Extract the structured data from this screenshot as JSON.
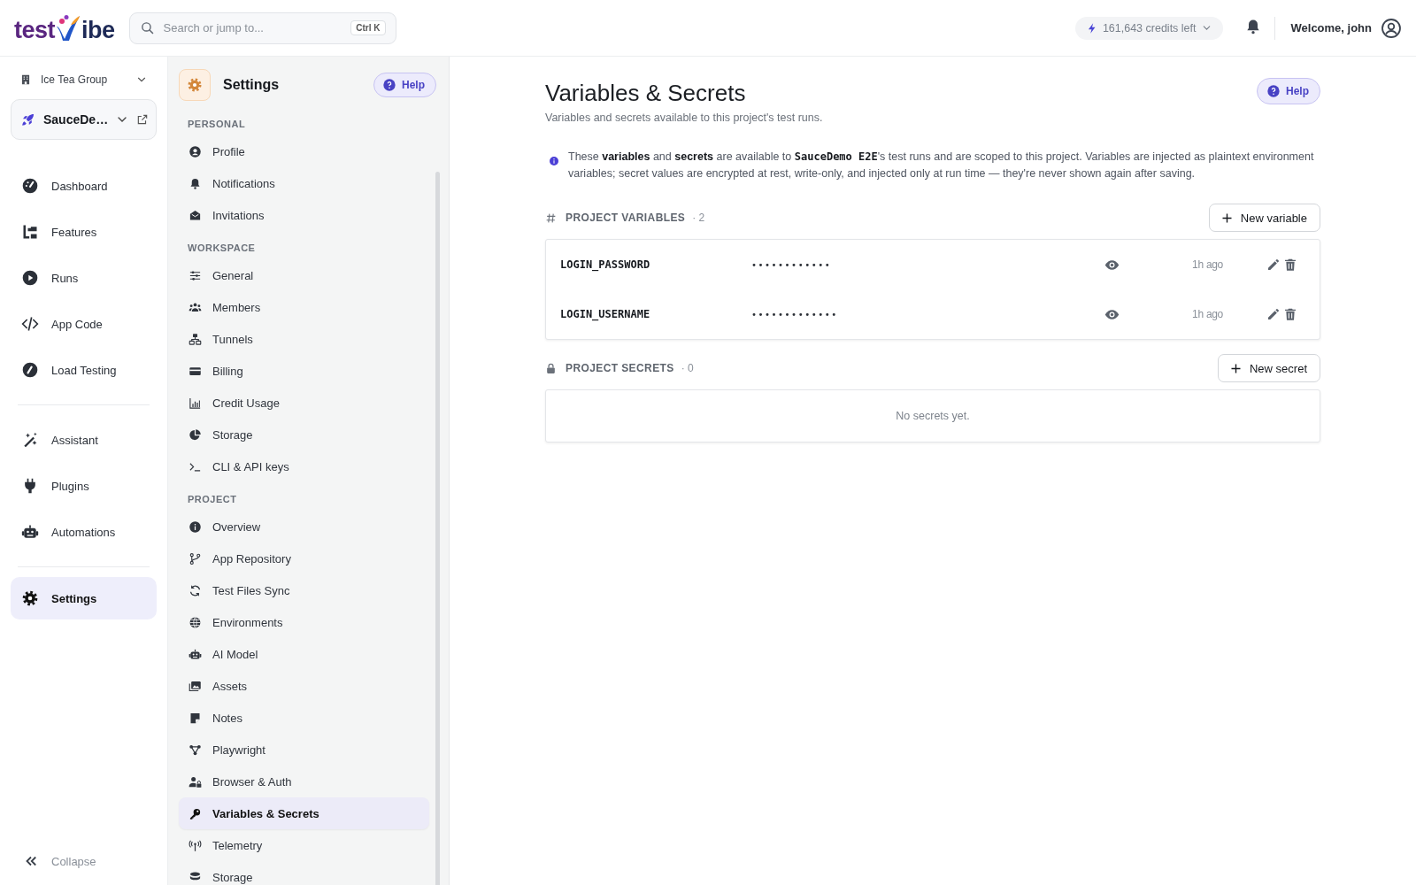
{
  "logo": {
    "before": "test",
    "after": "ibe"
  },
  "search": {
    "placeholder": "Search or jump to...",
    "shortcut": "Ctrl K"
  },
  "credits": "161,643 credits left",
  "welcome": "Welcome, john",
  "workspace": "Ice Tea Group",
  "project": "SauceDe…",
  "nav": {
    "groups": [
      [
        {
          "label": "Dashboard",
          "selected": false
        },
        {
          "label": "Features",
          "selected": false
        },
        {
          "label": "Runs",
          "selected": false
        },
        {
          "label": "App Code",
          "selected": false
        },
        {
          "label": "Load Testing",
          "selected": false
        }
      ],
      [
        {
          "label": "Assistant",
          "selected": false
        },
        {
          "label": "Plugins",
          "selected": false
        },
        {
          "label": "Automations",
          "selected": false
        }
      ],
      [
        {
          "label": "Settings",
          "selected": true
        }
      ]
    ]
  },
  "collapse": "Collapse",
  "settings_nav": {
    "title": "Settings",
    "help": "Help",
    "sections": [
      {
        "heading": "PERSONAL",
        "items": [
          {
            "label": "Profile",
            "selected": false
          },
          {
            "label": "Notifications",
            "selected": false
          },
          {
            "label": "Invitations",
            "selected": false
          }
        ]
      },
      {
        "heading": "WORKSPACE",
        "items": [
          {
            "label": "General",
            "selected": false
          },
          {
            "label": "Members",
            "selected": false
          },
          {
            "label": "Tunnels",
            "selected": false
          },
          {
            "label": "Billing",
            "selected": false
          },
          {
            "label": "Credit Usage",
            "selected": false
          },
          {
            "label": "Storage",
            "selected": false
          },
          {
            "label": "CLI & API keys",
            "selected": false
          }
        ]
      },
      {
        "heading": "PROJECT",
        "items": [
          {
            "label": "Overview",
            "selected": false
          },
          {
            "label": "App Repository",
            "selected": false
          },
          {
            "label": "Test Files Sync",
            "selected": false
          },
          {
            "label": "Environments",
            "selected": false
          },
          {
            "label": "AI Model",
            "selected": false
          },
          {
            "label": "Assets",
            "selected": false
          },
          {
            "label": "Notes",
            "selected": false
          },
          {
            "label": "Playwright",
            "selected": false
          },
          {
            "label": "Browser & Auth",
            "selected": false
          },
          {
            "label": "Variables & Secrets",
            "selected": true
          },
          {
            "label": "Telemetry",
            "selected": false
          },
          {
            "label": "Storage",
            "selected": false
          }
        ]
      }
    ]
  },
  "page": {
    "title": "Variables & Secrets",
    "subtitle": "Variables and secrets available to this project's test runs.",
    "help": "Help",
    "info": [
      {
        "kind": "plain",
        "text": "These "
      },
      {
        "kind": "bold",
        "text": "variables"
      },
      {
        "kind": "plain",
        "text": " and "
      },
      {
        "kind": "bold",
        "text": "secrets"
      },
      {
        "kind": "plain",
        "text": " are available to "
      },
      {
        "kind": "code",
        "text": "SauceDemo E2E"
      },
      {
        "kind": "plain",
        "text": "'s test runs and are scoped to this project. Variables are injected as plaintext environment variables; secret values are encrypted at rest, write-only, and injected only at run time — they're never shown again after saving."
      }
    ]
  },
  "variables": {
    "heading": "PROJECT VARIABLES",
    "count": "· 2",
    "button": "New variable",
    "rows": [
      {
        "name": "LOGIN_PASSWORD",
        "value": "••••••••••••",
        "updated": "1h ago"
      },
      {
        "name": "LOGIN_USERNAME",
        "value": "•••••••••••••",
        "updated": "1h ago"
      }
    ]
  },
  "secrets": {
    "heading": "PROJECT SECRETS",
    "count": "· 0",
    "button": "New secret",
    "empty": "No secrets yet."
  }
}
